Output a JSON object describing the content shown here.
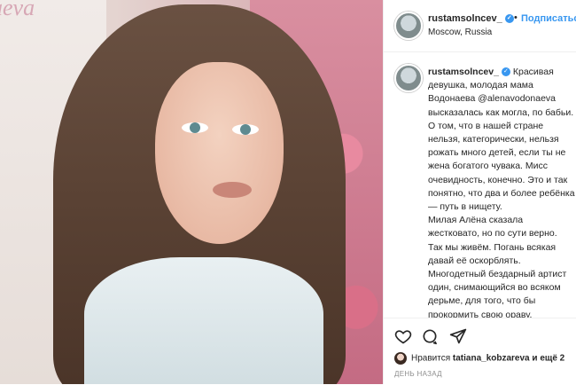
{
  "photo": {
    "watermark": "aeva"
  },
  "post": {
    "username": "rustamsolncev_",
    "follow_label": "Подписаться",
    "dot": "•",
    "location": "Moscow, Russia",
    "caption": "Красивая девушка, молодая мама Водонаева @alenavodonaeva высказалась как могла, по бабьи. О том, что в нашей стране нельзя, категорически, нельзя рожать много детей, если ты не жена богатого чувака. Мисс очевидность, конечно. Это и так понятно, что два и более ребёнка — путь в нищету.\nМилая Алёна сказала жестковато, но по сути верно.\nТак мы живём. Погань всякая давай её оскорблять. Многодетный бездарный артист один, снимающийся во всяком дерьме, для того, что бы прокормить свою ораву, проституткой назвал.\nДепутаты разные возмутились. Д"
  },
  "likes": {
    "prefix": "Нравится ",
    "user": "tatiana_kobzareva",
    "suffix": " и ещё 2",
    "time": "ДЕНЬ НАЗАД"
  },
  "icons": [
    "heart-icon",
    "comment-icon",
    "share-icon",
    "verified-badge-icon"
  ],
  "colors": {
    "accent": "#3897f0",
    "text": "#262626",
    "muted": "#8e8e8e"
  }
}
